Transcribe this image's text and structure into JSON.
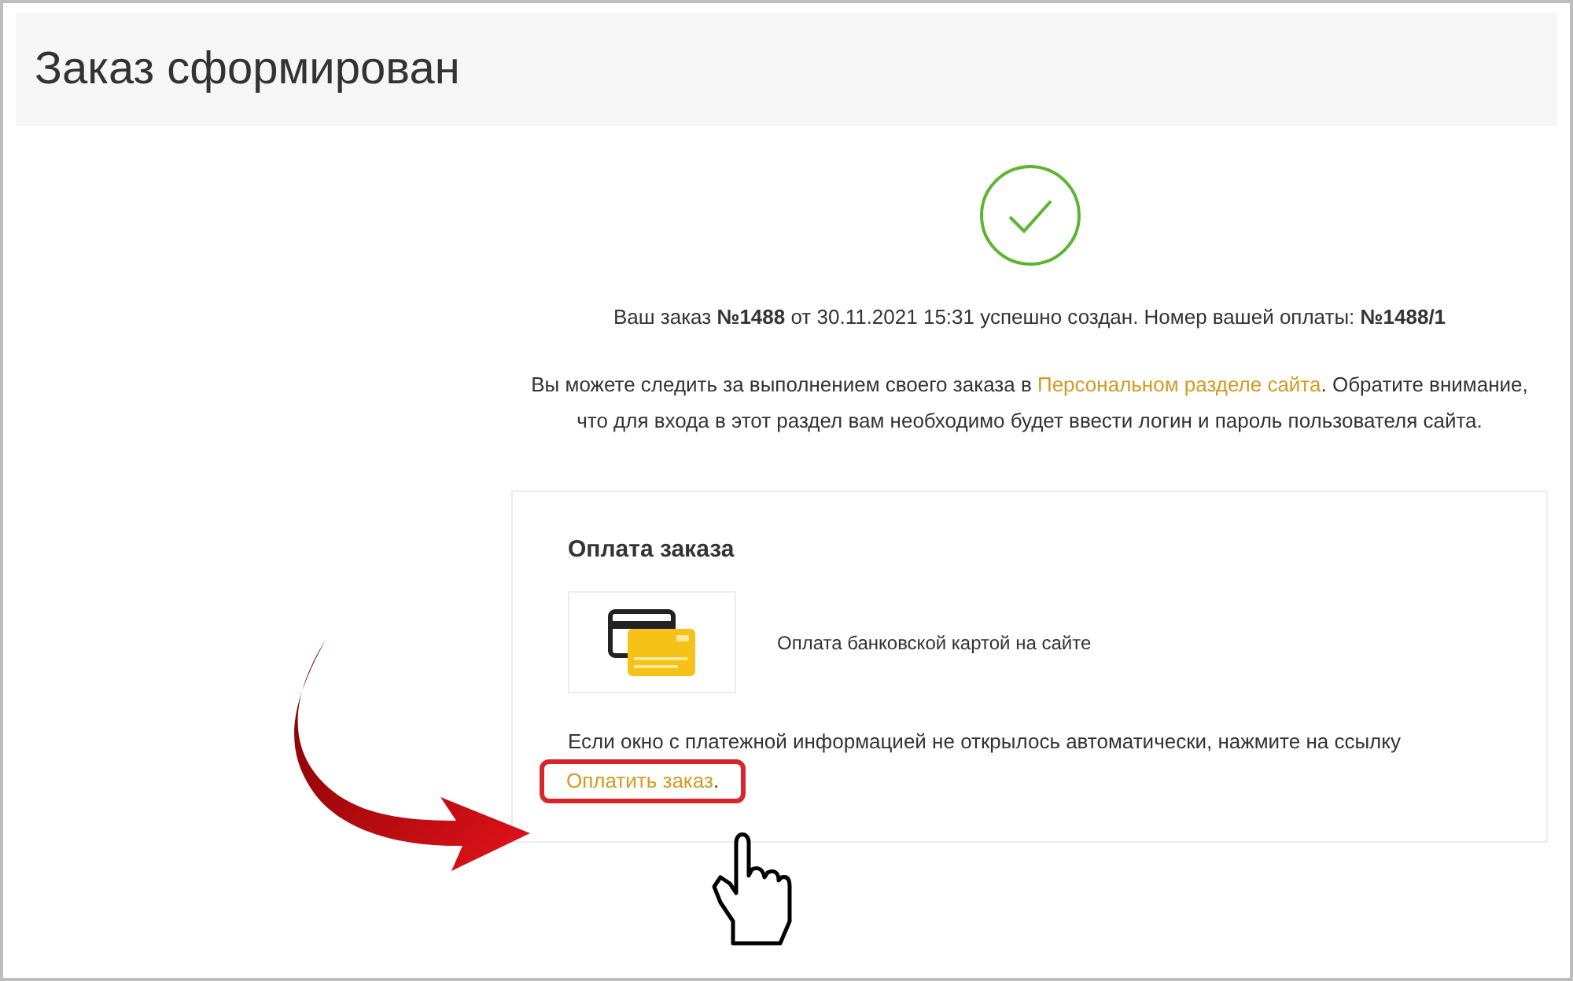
{
  "page_title": "Заказ сформирован",
  "order_line": "Ваш заказ **№1488** от 30.11.2021 15:31 успешно создан. Номер вашей оплаты: **№1488/1**",
  "info": {
    "before": "Вы можете следить за выполнением своего заказа в ",
    "link": "Персональном разделе сайта",
    "after": ". Обратите внимание, что для входа в этот раздел вам необходимо будет ввести логин и пароль пользователя сайта."
  },
  "payment": {
    "title": "Оплата заказа",
    "method": "Оплата банковской картой на сайте",
    "hint": "Если окно с платежной информацией не открылось автоматически, нажмите на ссылку",
    "link": "Оплатить заказ",
    "link_tail": "."
  }
}
